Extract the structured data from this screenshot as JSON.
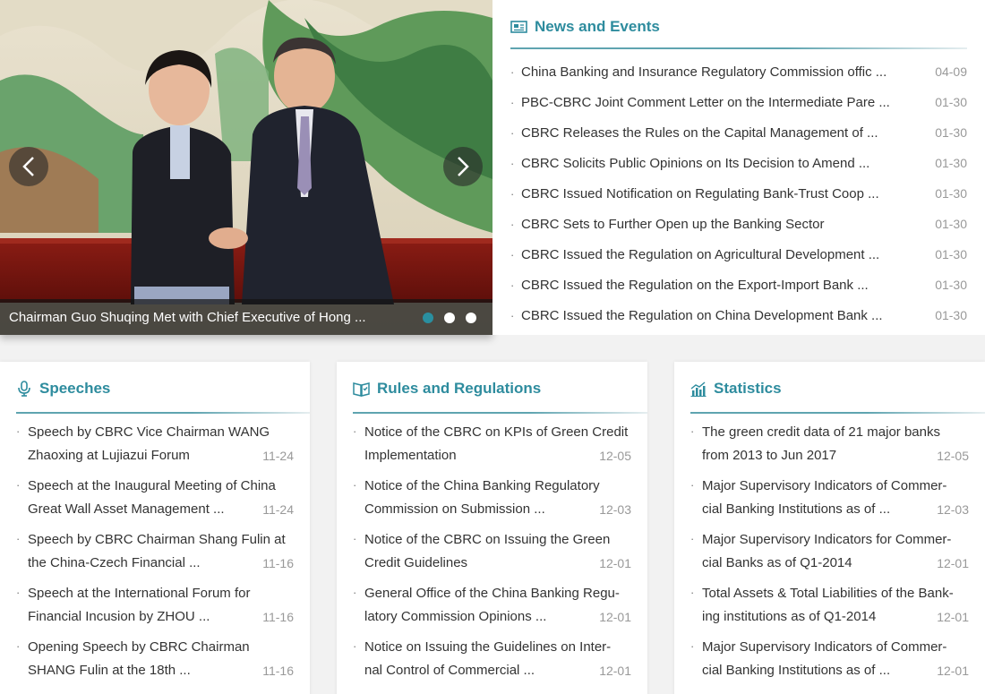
{
  "carousel": {
    "caption": "Chairman Guo Shuqing Met with Chief Executive of Hong ...",
    "dot_count": 3,
    "active_dot": 0
  },
  "news": {
    "title": "News and Events",
    "items": [
      {
        "text": "China Banking and Insurance Regulatory Commission offic ...",
        "date": "04-09"
      },
      {
        "text": "PBC-CBRC Joint Comment Letter on the Intermediate Pare ...",
        "date": "01-30"
      },
      {
        "text": "CBRC Releases the Rules on the Capital Management of ...",
        "date": "01-30"
      },
      {
        "text": "CBRC Solicits Public Opinions on Its Decision to Amend ...",
        "date": "01-30"
      },
      {
        "text": "CBRC Issued Notification on Regulating Bank-Trust Coop ...",
        "date": "01-30"
      },
      {
        "text": "CBRC Sets to Further Open up the Banking Sector",
        "date": "01-30"
      },
      {
        "text": "CBRC Issued the Regulation on Agricultural Development ...",
        "date": "01-30"
      },
      {
        "text": "CBRC Issued the Regulation on the Export-Import Bank ...",
        "date": "01-30"
      },
      {
        "text": "CBRC Issued the Regulation on China Development Bank ...",
        "date": "01-30"
      }
    ]
  },
  "speeches": {
    "title": "Speeches",
    "items": [
      {
        "l1": "Speech by CBRC Vice Chairman WANG",
        "l2": "Zhaoxing at Lujiazui Forum",
        "date": "11-24"
      },
      {
        "l1": "Speech at the Inaugural Meeting of China",
        "l2": "Great Wall Asset Management ...",
        "date": "11-24"
      },
      {
        "l1": "Speech by CBRC Chairman Shang Fulin at",
        "l2": "the China-Czech Financial  ...",
        "date": "11-16"
      },
      {
        "l1": "Speech at the International Forum for",
        "l2": "Financial Incusion by ZHOU ...",
        "date": "11-16"
      },
      {
        "l1": "Opening Speech by CBRC Chairman",
        "l2": "SHANG Fulin at the 18th ...",
        "date": "11-16"
      }
    ]
  },
  "rules": {
    "title": "Rules and Regulations",
    "items": [
      {
        "l1": "Notice of the CBRC on KPIs of Green Credit",
        "l2": "Implementation",
        "date": "12-05"
      },
      {
        "l1": "Notice of the China Banking Regulatory",
        "l2": "Commission on Submission ...",
        "date": "12-03"
      },
      {
        "l1": "Notice of the CBRC on Issuing the Green",
        "l2": "Credit Guidelines",
        "date": "12-01"
      },
      {
        "l1": "General Office of the China Banking Regu-",
        "l2": "latory Commission Opinions ...",
        "date": "12-01"
      },
      {
        "l1": "Notice on Issuing the Guidelines on Inter-",
        "l2": "nal Control of Commercial ...",
        "date": "12-01"
      }
    ]
  },
  "statistics": {
    "title": "Statistics",
    "items": [
      {
        "l1": "The green credit data of 21 major banks",
        "l2": "from 2013 to Jun 2017",
        "date": "12-05"
      },
      {
        "l1": "Major Supervisory Indicators of Commer-",
        "l2": "cial Banking Institutions as of ...",
        "date": "12-03"
      },
      {
        "l1": "Major Supervisory Indicators for Commer-",
        "l2": "cial Banks as of Q1-2014",
        "date": "12-01"
      },
      {
        "l1": "Total Assets & Total Liabilities of the Bank-",
        "l2": "ing institutions as of Q1-2014",
        "date": "12-01"
      },
      {
        "l1": "Major Supervisory Indicators of Commer-",
        "l2": "cial Banking Institutions as of ...",
        "date": "12-01"
      }
    ]
  },
  "colors": {
    "accent": "#2e8c9e",
    "date": "#999999",
    "active_dot": "#2a8fa0"
  }
}
